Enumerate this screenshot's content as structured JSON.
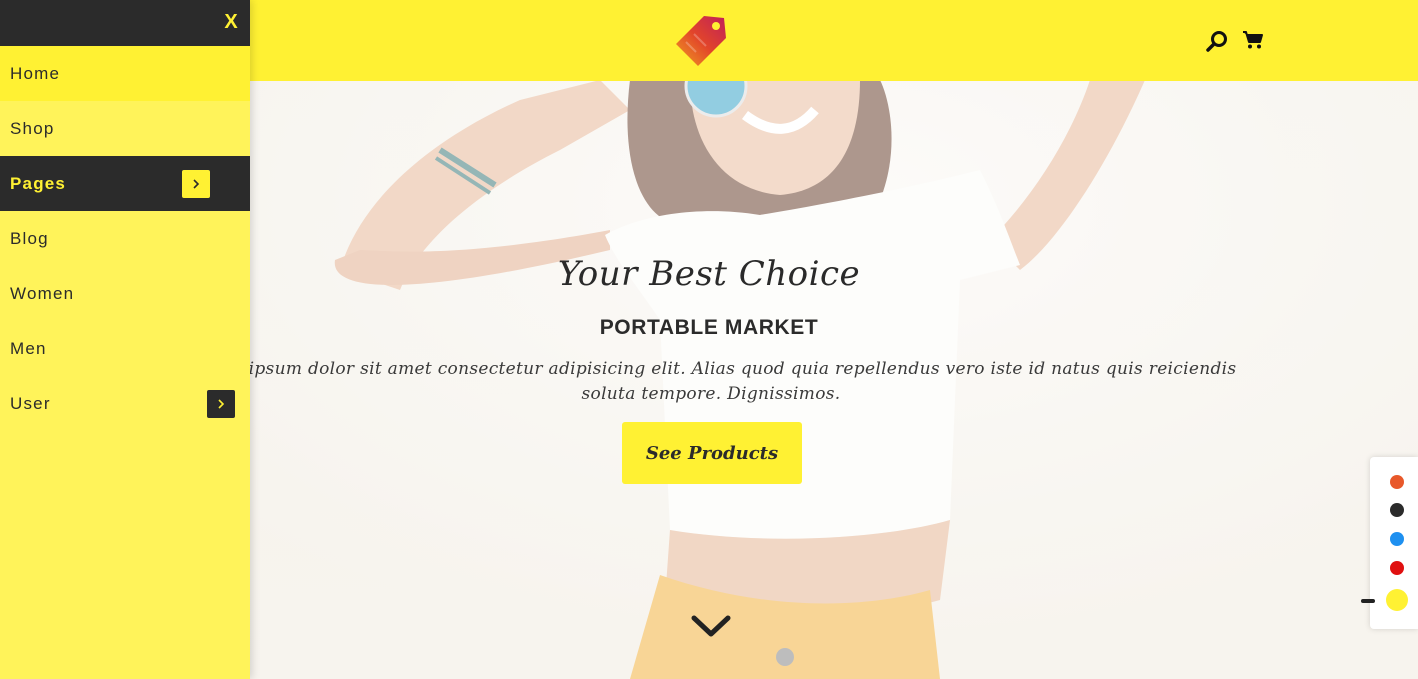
{
  "hero": {
    "title": "Your Best Choice",
    "subtitle": "PORTABLE MARKET",
    "text": "Lorem ipsum dolor sit amet consectetur adipisicing elit. Alias quod quia repellendus vero iste id natus quis reiciendis soluta tempore. Dignissimos.",
    "cta_label": "See Products"
  },
  "header": {
    "logo_icon": "price-tag-logo",
    "search_icon": "search-icon",
    "cart_icon": "cart-icon"
  },
  "menu": {
    "close_label": "X",
    "items": [
      {
        "label": "Home"
      },
      {
        "label": "Shop"
      },
      {
        "label": "Pages",
        "has_submenu": true,
        "active": true
      },
      {
        "label": "Blog"
      },
      {
        "label": "Women"
      },
      {
        "label": "Men"
      },
      {
        "label": "User",
        "has_submenu": true
      }
    ]
  },
  "color_switcher": {
    "swatches": [
      "#e8582a",
      "#2b2b2b",
      "#1e90f0",
      "#e01010",
      "#fff133"
    ],
    "active": "#fff133"
  },
  "colors": {
    "accent": "#fff133",
    "dark": "#2b2b2b"
  }
}
